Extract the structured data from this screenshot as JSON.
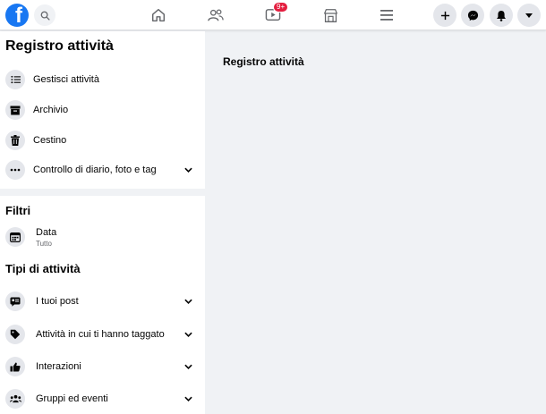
{
  "topbar": {
    "logo_letter": "f",
    "icons": [
      "facebook-logo",
      "search-icon",
      "home-icon",
      "friends-icon",
      "watch-icon",
      "marketplace-icon",
      "menu-icon",
      "plus-icon",
      "messenger-icon",
      "notifications-icon",
      "caret-down-icon"
    ],
    "watch_badge": "9+"
  },
  "sidebar": {
    "title": "Registro attività",
    "items": [
      {
        "label": "Gestisci attività",
        "icon": "list-icon"
      },
      {
        "label": "Archivio",
        "icon": "archive-icon"
      },
      {
        "label": "Cestino",
        "icon": "trash-icon"
      },
      {
        "label": "Controllo di diario, foto e tag",
        "icon": "more-icon"
      }
    ],
    "filters_title": "Filtri",
    "filter": {
      "label": "Data",
      "value": "Tutto",
      "icon": "calendar-icon"
    },
    "types_title": "Tipi di attività",
    "types": [
      {
        "label": "I tuoi post",
        "icon": "post-icon"
      },
      {
        "label": "Attività in cui ti hanno taggato",
        "icon": "tag-icon"
      },
      {
        "label": "Interazioni",
        "icon": "like-icon"
      },
      {
        "label": "Gruppi ed eventi",
        "icon": "groups-icon"
      }
    ]
  },
  "main": {
    "title": "Registro attività"
  },
  "colors": {
    "brand": "#1877f2",
    "badge": "#e41e3f",
    "background": "#f0f2f5",
    "icon_bg": "#e4e6eb"
  }
}
